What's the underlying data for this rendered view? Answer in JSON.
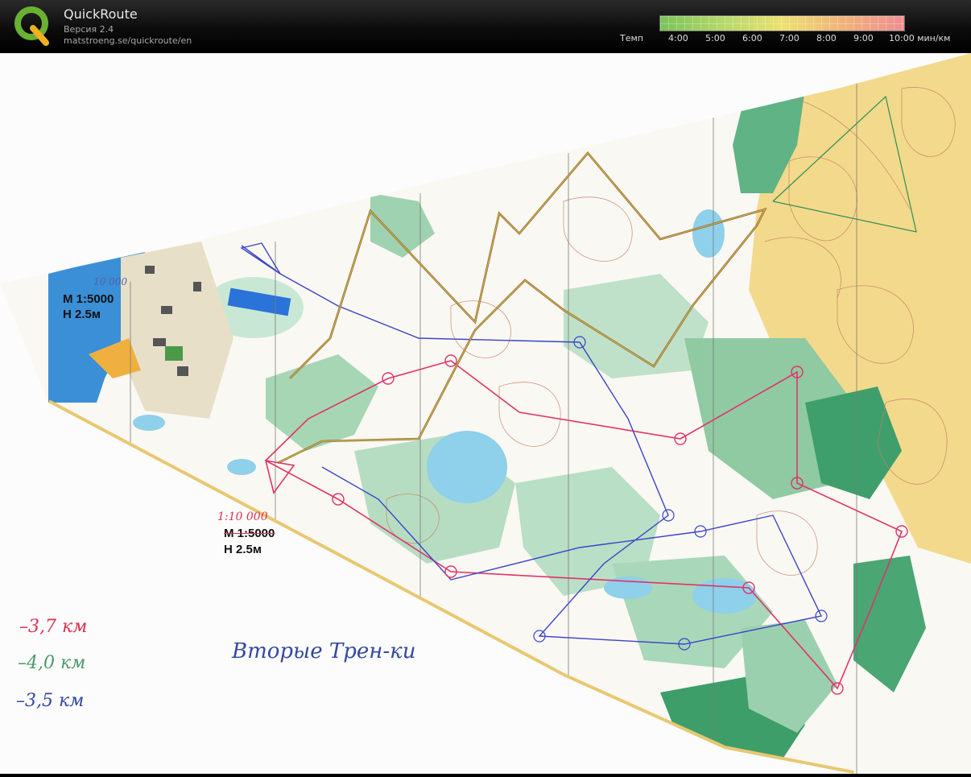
{
  "app": {
    "title": "QuickRoute",
    "version": "Версия 2.4",
    "url": "matstroeng.se/quickroute/en"
  },
  "pace_legend": {
    "label": "Темп",
    "ticks": [
      "4:00",
      "5:00",
      "6:00",
      "7:00",
      "8:00",
      "9:00",
      "10:00 мин/км"
    ],
    "colors": [
      "#7ac25a",
      "#b3d86a",
      "#ece170",
      "#f1b27a",
      "#ee8e93"
    ]
  },
  "map": {
    "scale_block_1": {
      "handwritten": "10 000",
      "scale": "М 1:5000",
      "contour": "Н 2.5м"
    },
    "scale_block_2": {
      "handwritten": "1:10 000",
      "scale": "М 1:5000",
      "contour": "Н 2.5м"
    },
    "distances": [
      {
        "text": "–3,7 км",
        "color": "#d9334f"
      },
      {
        "text": "–4,0 км",
        "color": "#4a9a6a"
      },
      {
        "text": "–3,5 км",
        "color": "#3348a0"
      }
    ],
    "caption": "Вторые Трен-ки"
  }
}
